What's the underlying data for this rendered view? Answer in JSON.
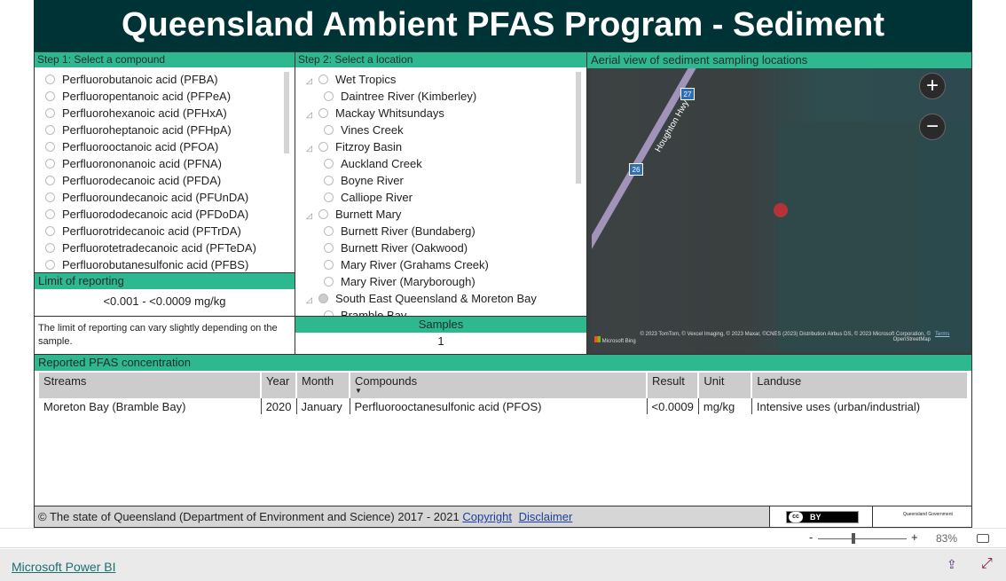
{
  "title": "Queensland Ambient PFAS Program - Sediment",
  "step1": {
    "header": "Step 1: Select a compound",
    "items": [
      "Perfluorobutanoic acid (PFBA)",
      "Perfluoropentanoic acid (PFPeA)",
      "Perfluorohexanoic acid (PFHxA)",
      "Perfluoroheptanoic acid (PFHpA)",
      "Perfluorooctanoic acid (PFOA)",
      "Perfluorononanoic acid (PFNA)",
      "Perfluorodecanoic acid (PFDA)",
      "Perfluoroundecanoic acid (PFUnDA)",
      "Perfluorododecanoic acid (PFDoDA)",
      "Perfluorotridecanoic acid (PFTrDA)",
      "Perfluorotetradecanoic acid (PFTeDA)",
      "Perfluorobutanesulfonic acid (PFBS)"
    ]
  },
  "limit": {
    "header": "Limit of reporting",
    "value": "<0.001 - <0.0009 mg/kg",
    "note": "The limit of reporting can vary slightly depending on the sample."
  },
  "step2": {
    "header": "Step 2: Select a location",
    "items": [
      {
        "label": "Wet Tropics",
        "level": 0
      },
      {
        "label": "Daintree River (Kimberley)",
        "level": 1
      },
      {
        "label": "Mackay Whitsundays",
        "level": 0
      },
      {
        "label": "Vines Creek",
        "level": 1
      },
      {
        "label": "Fitzroy Basin",
        "level": 0
      },
      {
        "label": "Auckland Creek",
        "level": 1
      },
      {
        "label": "Boyne River",
        "level": 1
      },
      {
        "label": "Calliope River",
        "level": 1
      },
      {
        "label": "Burnett Mary",
        "level": 0
      },
      {
        "label": "Burnett River (Bundaberg)",
        "level": 1
      },
      {
        "label": "Burnett River (Oakwood)",
        "level": 1
      },
      {
        "label": "Mary River (Grahams Creek)",
        "level": 1
      },
      {
        "label": "Mary River (Maryborough)",
        "level": 1
      },
      {
        "label": "South East Queensland & Moreton Bay",
        "level": 0,
        "selected": true
      },
      {
        "label": "Bramble Bay",
        "level": 1
      }
    ]
  },
  "samples": {
    "header": "Samples",
    "value": "1"
  },
  "map": {
    "header": "Aerial view of sediment sampling locations",
    "road_label": "Houghton Hwy",
    "shield1": "27",
    "shield2": "26",
    "attribution": "© 2023 TomTom, © Vexcel Imaging, © 2023 Maxar, ©CNES (2023) Distribution Airbus DS, © 2023 Microsoft Corporation, © OpenStreetMap",
    "terms": "Terms",
    "bing": "Microsoft Bing",
    "marker_color": "#b5323a"
  },
  "table": {
    "header": "Reported PFAS concentration",
    "columns": [
      "Streams",
      "Year",
      "Month",
      "Compounds",
      "Result",
      "Unit",
      "Landuse"
    ],
    "rows": [
      [
        "Moreton Bay (Bramble Bay)",
        "2020",
        "January",
        "Perfluorooctanesulfonic acid (PFOS)",
        "<0.0009",
        "mg/kg",
        "Intensive uses (urban/industrial)"
      ]
    ]
  },
  "footer": {
    "text": "© The state of Queensland (Department of Environment and Science) 2017 - 2021",
    "copyright": "Copyright",
    "disclaimer": "Disclaimer",
    "cc": "BY",
    "qld": "Queensland Government"
  },
  "zoom": {
    "minus": "-",
    "plus": "+",
    "level": "83%"
  },
  "bottom": {
    "brand": "Microsoft Power BI"
  },
  "colors": {
    "title_bg": "#003335",
    "accent": "#2db890"
  }
}
